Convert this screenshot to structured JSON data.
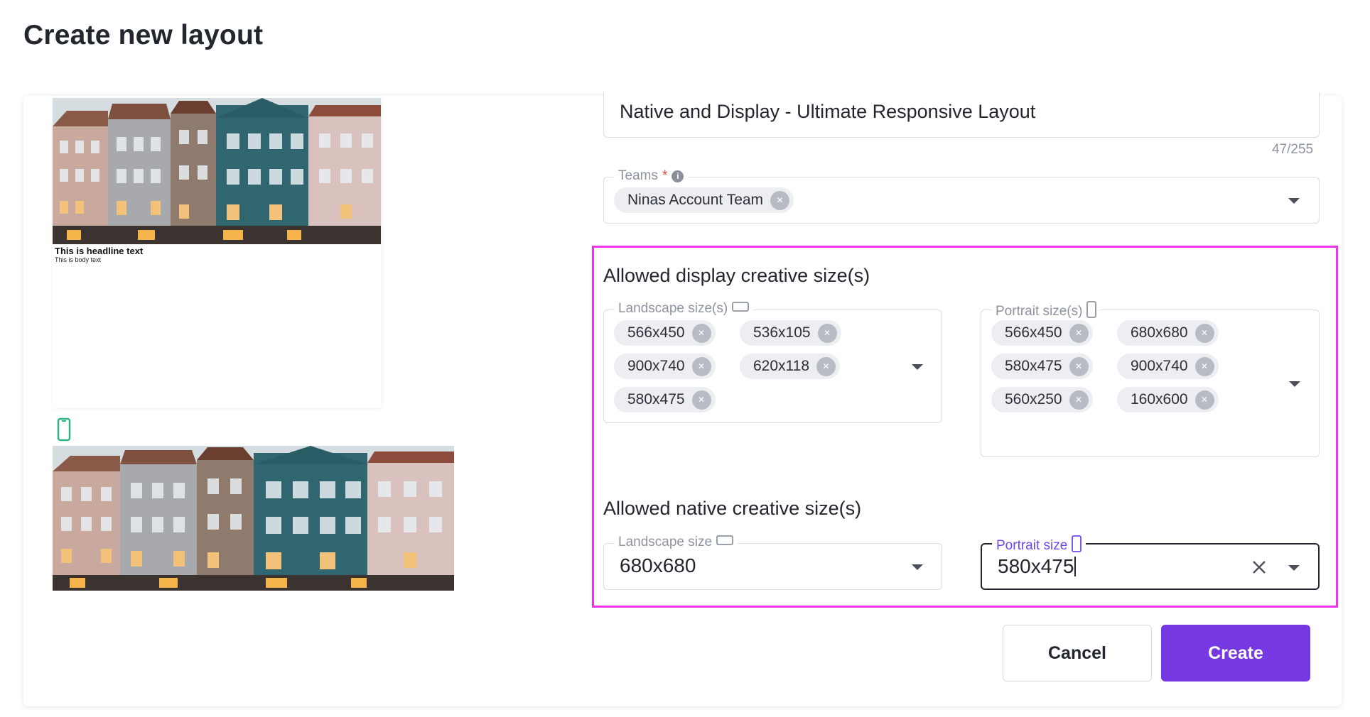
{
  "page": {
    "title": "Create new layout"
  },
  "preview": {
    "headline": "This is headline text",
    "body": "This is body text",
    "landscape_icon": "landscape-device-icon",
    "portrait_icon": "portrait-phone-icon"
  },
  "form": {
    "layout_name": {
      "value": "Native and Display - Ultimate Responsive Layout",
      "char_count": "47/255"
    },
    "teams": {
      "label": "Teams",
      "required_mark": "*",
      "info_icon": "i",
      "selected": [
        "Ninas Account Team"
      ]
    },
    "display_sizes": {
      "title": "Allowed display creative size(s)",
      "landscape": {
        "label": "Landscape size(s)",
        "chips": [
          "566x450",
          "536x105",
          "900x740",
          "620x118",
          "580x475"
        ]
      },
      "portrait": {
        "label": "Portrait size(s)",
        "chips": [
          "566x450",
          "680x680",
          "580x475",
          "900x740",
          "560x250",
          "160x600"
        ]
      }
    },
    "native_sizes": {
      "title": "Allowed native creative size(s)",
      "landscape": {
        "label": "Landscape size",
        "value": "680x680"
      },
      "portrait": {
        "label": "Portrait size",
        "value": "580x475"
      }
    }
  },
  "actions": {
    "cancel": "Cancel",
    "create": "Create"
  },
  "colors": {
    "accent": "#7538E3",
    "highlight": "#EE33E9",
    "focus_label": "#7047EB"
  }
}
